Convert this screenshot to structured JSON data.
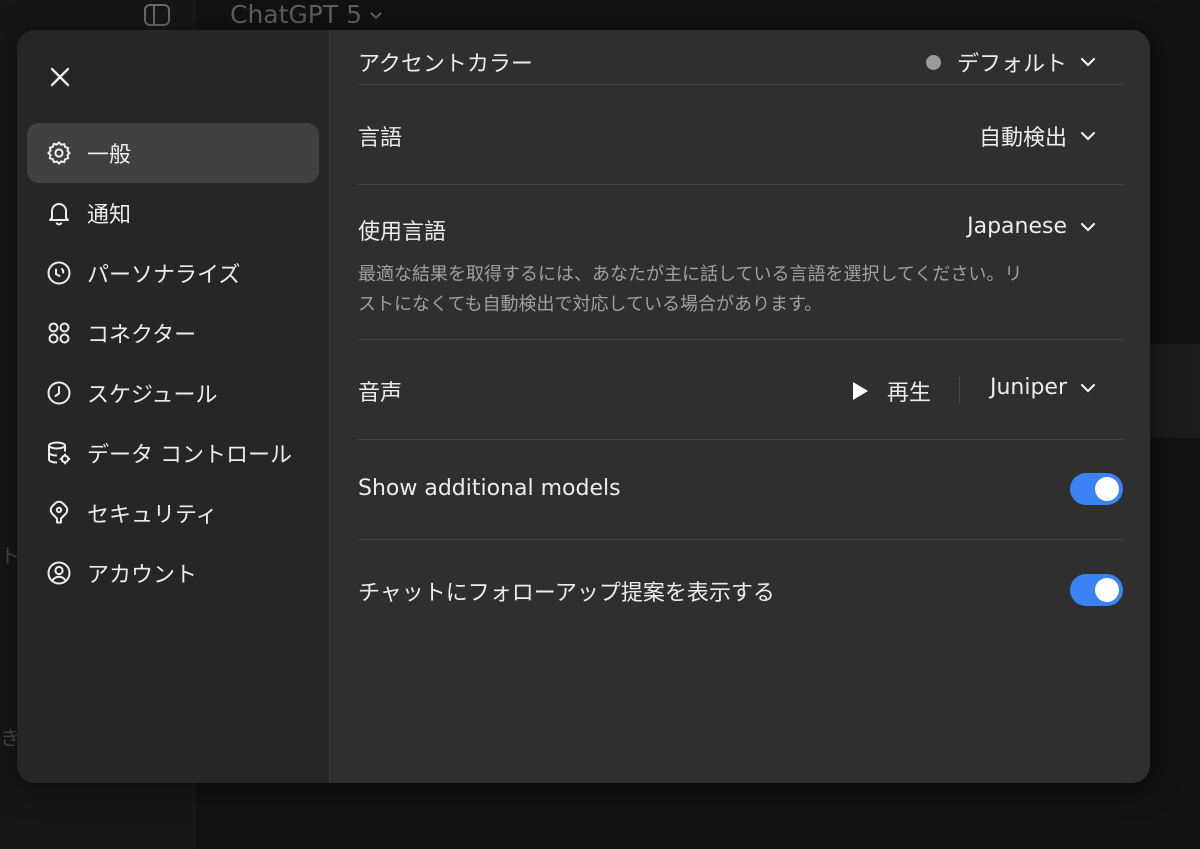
{
  "background": {
    "app_title": "ChatGPT 5",
    "fragments": [
      "ト",
      "き"
    ]
  },
  "nav": {
    "items": [
      {
        "label": "一般",
        "icon": "gear-icon",
        "active": true
      },
      {
        "label": "通知",
        "icon": "bell-icon"
      },
      {
        "label": "パーソナライズ",
        "icon": "personalize-icon"
      },
      {
        "label": "コネクター",
        "icon": "connectors-icon"
      },
      {
        "label": "スケジュール",
        "icon": "clock-icon"
      },
      {
        "label": "データ コントロール",
        "icon": "database-gear-icon"
      },
      {
        "label": "セキュリティ",
        "icon": "security-icon"
      },
      {
        "label": "アカウント",
        "icon": "user-circle-icon"
      }
    ]
  },
  "settings": {
    "accent": {
      "label": "アクセントカラー",
      "value": "デフォルト"
    },
    "language": {
      "label": "言語",
      "value": "自動検出"
    },
    "spoken": {
      "label": "使用言語",
      "value": "Japanese",
      "description": "最適な結果を取得するには、あなたが主に話している言語を選択してください。リストになくても自動検出で対応している場合があります。"
    },
    "voice": {
      "label": "音声",
      "play_label": "再生",
      "value": "Juniper"
    },
    "additional_models": {
      "label": "Show additional models",
      "enabled": true
    },
    "followups": {
      "label": "チャットにフォローアップ提案を表示する",
      "enabled": true
    }
  },
  "colors": {
    "accent_toggle": "#3b82f6",
    "modal_bg": "#2f2f2f",
    "nav_bg": "#262626"
  }
}
